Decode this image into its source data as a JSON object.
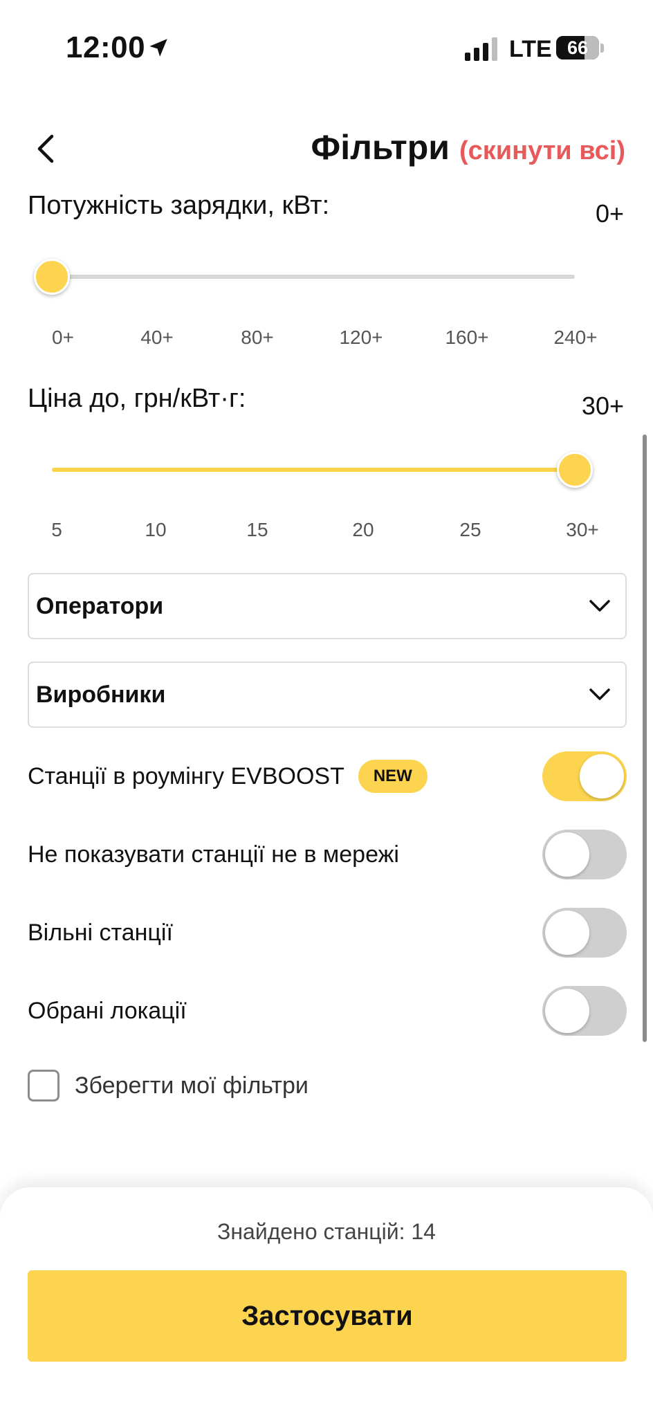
{
  "status_bar": {
    "time": "12:00",
    "network": "LTE",
    "battery_level": 66,
    "battery_text": "66"
  },
  "header": {
    "title": "Фільтри",
    "reset_label": "(скинути всі)"
  },
  "power_filter": {
    "label": "Потужність зарядки, кВт:",
    "value_text": "0+",
    "selected_index": 0,
    "ticks": [
      "0+",
      "40+",
      "80+",
      "120+",
      "160+",
      "240+"
    ]
  },
  "price_filter": {
    "label": "Ціна до, грн/кВт·г:",
    "value_text": "30+",
    "selected_index": 5,
    "ticks": [
      "5",
      "10",
      "15",
      "20",
      "25",
      "30+"
    ]
  },
  "dropdowns": {
    "operators_label": "Оператори",
    "manufacturers_label": "Виробники"
  },
  "toggles": {
    "roaming": {
      "label": "Станції в роумінгу EVBOOST",
      "badge": "NEW",
      "on": true
    },
    "hide_offline": {
      "label": "Не показувати станції не в мережі",
      "on": false
    },
    "free_stations": {
      "label": "Вільні станції",
      "on": false
    },
    "favorites": {
      "label": "Обрані локації",
      "on": false
    }
  },
  "save_filters": {
    "label": "Зберегти мої фільтри",
    "checked": false
  },
  "footer": {
    "found_text": "Знайдено станцій: 14",
    "apply_label": "Застосувати"
  },
  "colors": {
    "accent": "#fcd44f",
    "reset": "#e8595a",
    "toggle_off": "#cfcfcf"
  }
}
